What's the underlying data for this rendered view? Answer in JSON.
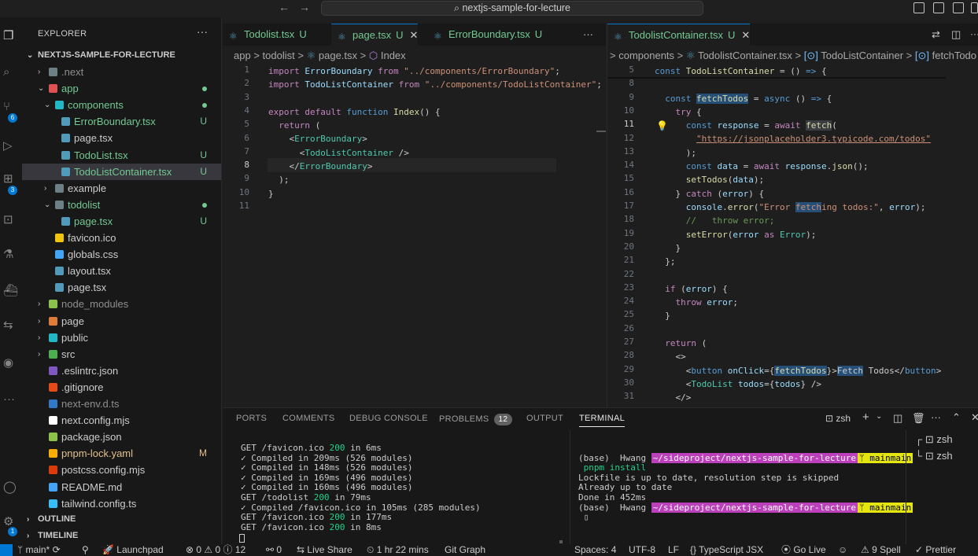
{
  "titlebar": {
    "search": "nextjs-sample-for-lecture",
    "search_icon": "search-icon"
  },
  "sidebar": {
    "header": "EXPLORER",
    "more": "···",
    "root": "NEXTJS-SAMPLE-FOR-LECTURE",
    "items": [
      {
        "name": ".next",
        "status": ""
      },
      {
        "name": "app",
        "status": "•"
      },
      {
        "name": "components",
        "status": "•"
      },
      {
        "name": "ErrorBoundary.tsx",
        "status": "U"
      },
      {
        "name": "page.tsx",
        "status": ""
      },
      {
        "name": "TodoList.tsx",
        "status": "U"
      },
      {
        "name": "TodoListContainer.tsx",
        "status": "U"
      },
      {
        "name": "example",
        "status": ""
      },
      {
        "name": "todolist",
        "status": "•"
      },
      {
        "name": "page.tsx",
        "status": "U"
      },
      {
        "name": "favicon.ico",
        "status": ""
      },
      {
        "name": "globals.css",
        "status": ""
      },
      {
        "name": "layout.tsx",
        "status": ""
      },
      {
        "name": "page.tsx",
        "status": ""
      },
      {
        "name": "node_modules",
        "status": ""
      },
      {
        "name": "page",
        "status": ""
      },
      {
        "name": "public",
        "status": ""
      },
      {
        "name": "src",
        "status": ""
      },
      {
        "name": ".eslintrc.json",
        "status": ""
      },
      {
        "name": ".gitignore",
        "status": ""
      },
      {
        "name": "next-env.d.ts",
        "status": ""
      },
      {
        "name": "next.config.mjs",
        "status": ""
      },
      {
        "name": "package.json",
        "status": ""
      },
      {
        "name": "pnpm-lock.yaml",
        "status": "M"
      },
      {
        "name": "postcss.config.mjs",
        "status": ""
      },
      {
        "name": "README.md",
        "status": ""
      },
      {
        "name": "tailwind.config.ts",
        "status": ""
      }
    ],
    "outline": "OUTLINE",
    "timeline": "TIMELINE"
  },
  "editor1": {
    "tabs": [
      {
        "label": "Todolist.tsx",
        "status": "U"
      },
      {
        "label": "page.tsx",
        "status": "U",
        "close": "✕"
      },
      {
        "label": "ErrorBoundary.tsx",
        "status": "U"
      }
    ],
    "more": "···",
    "breadcrumb": [
      "app",
      ">",
      "todolist",
      ">",
      "page.tsx",
      ">",
      "Index"
    ],
    "line_numbers": [
      "1",
      "2",
      "3",
      "4",
      "5",
      "6",
      "7",
      "8",
      "9",
      "10",
      "11"
    ]
  },
  "editor2": {
    "tab": {
      "label": "TodolistContainer.tsx",
      "status": "U",
      "close": "✕"
    },
    "breadcrumb": [
      "components",
      ">",
      "TodolistContainer.tsx",
      ">",
      "TodoListContainer",
      ">",
      "fetchTodo"
    ],
    "line_numbers": [
      "5",
      "8",
      "9",
      "10",
      "11",
      "12",
      "13",
      "14",
      "15",
      "16",
      "17",
      "18",
      "19",
      "20",
      "21",
      "22",
      "23",
      "24",
      "25",
      "26",
      "27",
      "28",
      "29",
      "30",
      "31"
    ]
  },
  "panel": {
    "tabs": [
      "PORTS",
      "COMMENTS",
      "DEBUG CONSOLE",
      "PROBLEMS",
      "OUTPUT",
      "TERMINAL"
    ],
    "problems_count": "12",
    "shell": "zsh",
    "terminals": [
      "zsh",
      "zsh"
    ],
    "left_output": [
      "GET /favicon.ico 200 in 6ms",
      "✓ Compiled in 209ms (526 modules)",
      "✓ Compiled in 148ms (526 modules)",
      "✓ Compiled in 169ms (496 modules)",
      "✓ Compiled in 160ms (496 modules)",
      "GET /todolist 200 in 79ms",
      "✓ Compiled /favicon.ico in 105ms (285 modules)",
      "GET /favicon.ico 200 in 177ms",
      "GET /favicon.ico 200 in 8ms"
    ],
    "right_output": {
      "prompt_base": "(base)",
      "user": "Hwang",
      "path": "~/sideproject/nextjs-sample-for-lecture",
      "branch": "mainmain",
      "cmd": "pnpm install",
      "lines": [
        "Lockfile is up to date, resolution step is skipped",
        "Already up to date",
        "Done in 452ms"
      ]
    }
  },
  "statusbar": {
    "branch": "main*",
    "launchpad": "Launchpad",
    "errors": "0",
    "warnings": "0",
    "info": "12",
    "ports": "0",
    "liveshare": "Live Share",
    "time": "1 hr 22 mins",
    "gitgraph": "Git Graph",
    "spaces": "Spaces: 4",
    "encoding": "UTF-8",
    "eol": "LF",
    "lang": "TypeScript JSX",
    "golive": "Go Live",
    "spell": "9 Spell",
    "prettier": "Prettier"
  },
  "colors": {
    "accent": "#0078d4",
    "untracked": "#73c991",
    "modified": "#e2c08d"
  }
}
